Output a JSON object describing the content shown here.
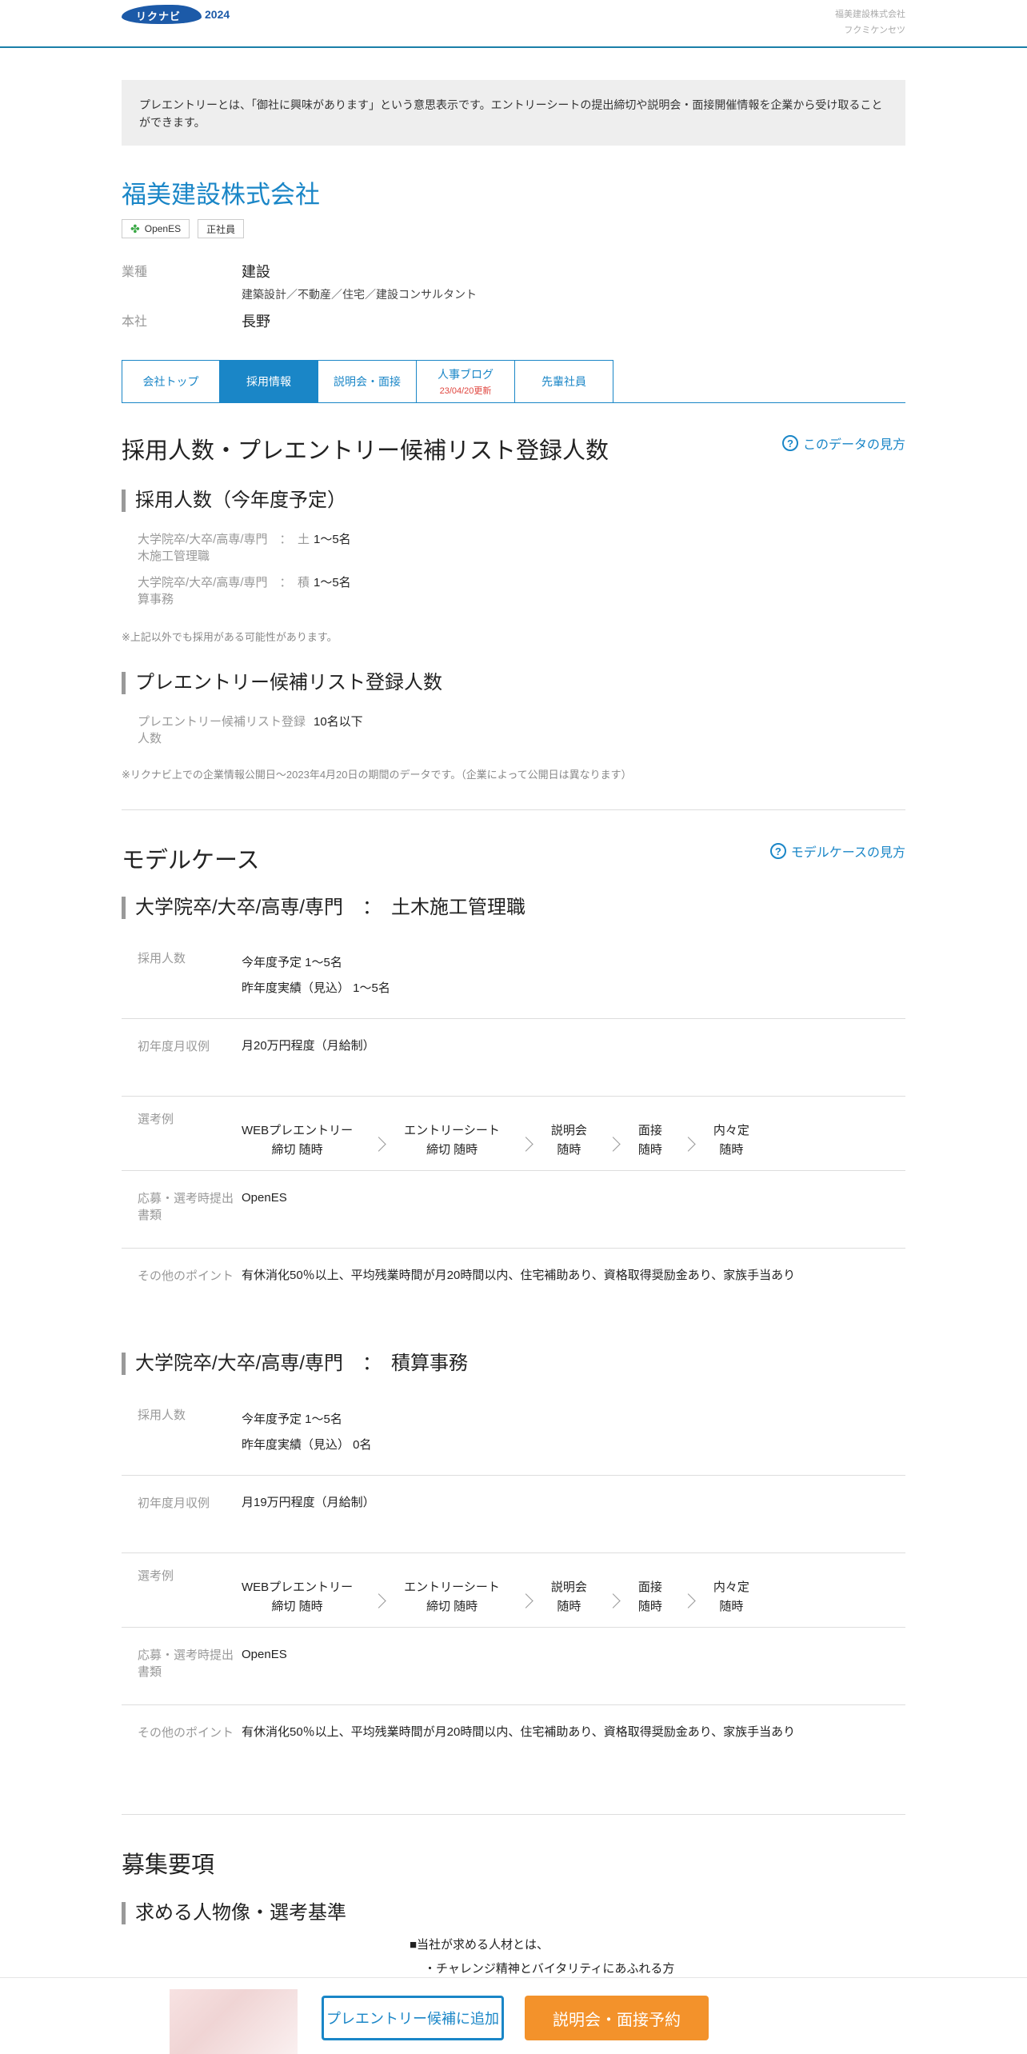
{
  "header": {
    "logo_text": "リクナビ",
    "logo_year": "2024",
    "company_name": "福美建設株式会社",
    "company_kana": "フクミケンセツ"
  },
  "notice": "プレエントリーとは、「御社に興味があります」という意思表示です。エントリーシートの提出締切や説明会・面接開催情報を企業から受け取ることができます。",
  "company": {
    "name": "福美建設株式会社",
    "tags": [
      "OpenES",
      "正社員"
    ],
    "industry_label": "業種",
    "industry": "建設",
    "industry_sub": "建築設計／不動産／住宅／建設コンサルタント",
    "hq_label": "本社",
    "hq": "長野"
  },
  "tabs": [
    {
      "label": "会社トップ",
      "active": false
    },
    {
      "label": "採用情報",
      "active": true
    },
    {
      "label": "説明会・面接",
      "active": false
    },
    {
      "label": "人事ブログ",
      "updated": "23/04/20更新",
      "active": false
    },
    {
      "label": "先輩社員",
      "active": false
    }
  ],
  "recruit_stats": {
    "title": "採用人数・プレエントリー候補リスト登録人数",
    "help_link": "このデータの見方",
    "hires_title": "採用人数（今年度予定）",
    "hires": [
      {
        "label": "大学院卒/大卒/高専/専門　：　土木施工管理職",
        "value": "1～5名"
      },
      {
        "label": "大学院卒/大卒/高専/専門　：　積算事務",
        "value": "1～5名"
      }
    ],
    "hires_note": "※上記以外でも採用がある可能性があります。",
    "list_title": "プレエントリー候補リスト登録人数",
    "list_label": "プレエントリー候補リスト登録人数",
    "list_value": "10名以下",
    "list_note": "※リクナビ上での企業情報公開日〜2023年4月20日の期間のデータです。（企業によって公開日は異なります）"
  },
  "model_case": {
    "title": "モデルケース",
    "help_link": "モデルケースの見方",
    "labels": {
      "hires": "採用人数",
      "salary": "初年度月収例",
      "selection": "選考例",
      "documents": "応募・選考時提出書類",
      "points": "その他のポイント"
    },
    "cases": [
      {
        "title": "大学院卒/大卒/高専/専門　：　土木施工管理職",
        "hires_this": "今年度予定 1～5名",
        "hires_last": "昨年度実績（見込） 1～5名",
        "salary": "月20万円程度（月給制）",
        "steps": [
          {
            "name": "WEBプレエントリー",
            "when": "締切 随時"
          },
          {
            "name": "エントリーシート",
            "when": "締切 随時"
          },
          {
            "name": "説明会",
            "when": "随時"
          },
          {
            "name": "面接",
            "when": "随時"
          },
          {
            "name": "内々定",
            "when": "随時"
          }
        ],
        "documents": "OpenES",
        "points": "有休消化50％以上、平均残業時間が月20時間以内、住宅補助あり、資格取得奨励金あり、家族手当あり"
      },
      {
        "title": "大学院卒/大卒/高専/専門　：　積算事務",
        "hires_this": "今年度予定 1～5名",
        "hires_last": "昨年度実績（見込） 0名",
        "salary": "月19万円程度（月給制）",
        "steps": [
          {
            "name": "WEBプレエントリー",
            "when": "締切 随時"
          },
          {
            "name": "エントリーシート",
            "when": "締切 随時"
          },
          {
            "name": "説明会",
            "when": "随時"
          },
          {
            "name": "面接",
            "when": "随時"
          },
          {
            "name": "内々定",
            "when": "随時"
          }
        ],
        "documents": "OpenES",
        "points": "有休消化50％以上、平均残業時間が月20時間以内、住宅補助あり、資格取得奨励金あり、家族手当あり"
      }
    ]
  },
  "requirements": {
    "title": "募集要項",
    "sub_title": "求める人物像・選考基準",
    "lines": [
      "■当社が求める人材とは、",
      "・チャレンジ精神とバイタリティにあふれる方"
    ]
  },
  "bottom_bar": {
    "entry_button": "プレエントリー候補に追加",
    "reserve_button": "説明会・面接予約"
  },
  "colors": {
    "accent": "#1a86c7",
    "orange": "#f3922b",
    "update_red": "#e0463f"
  }
}
